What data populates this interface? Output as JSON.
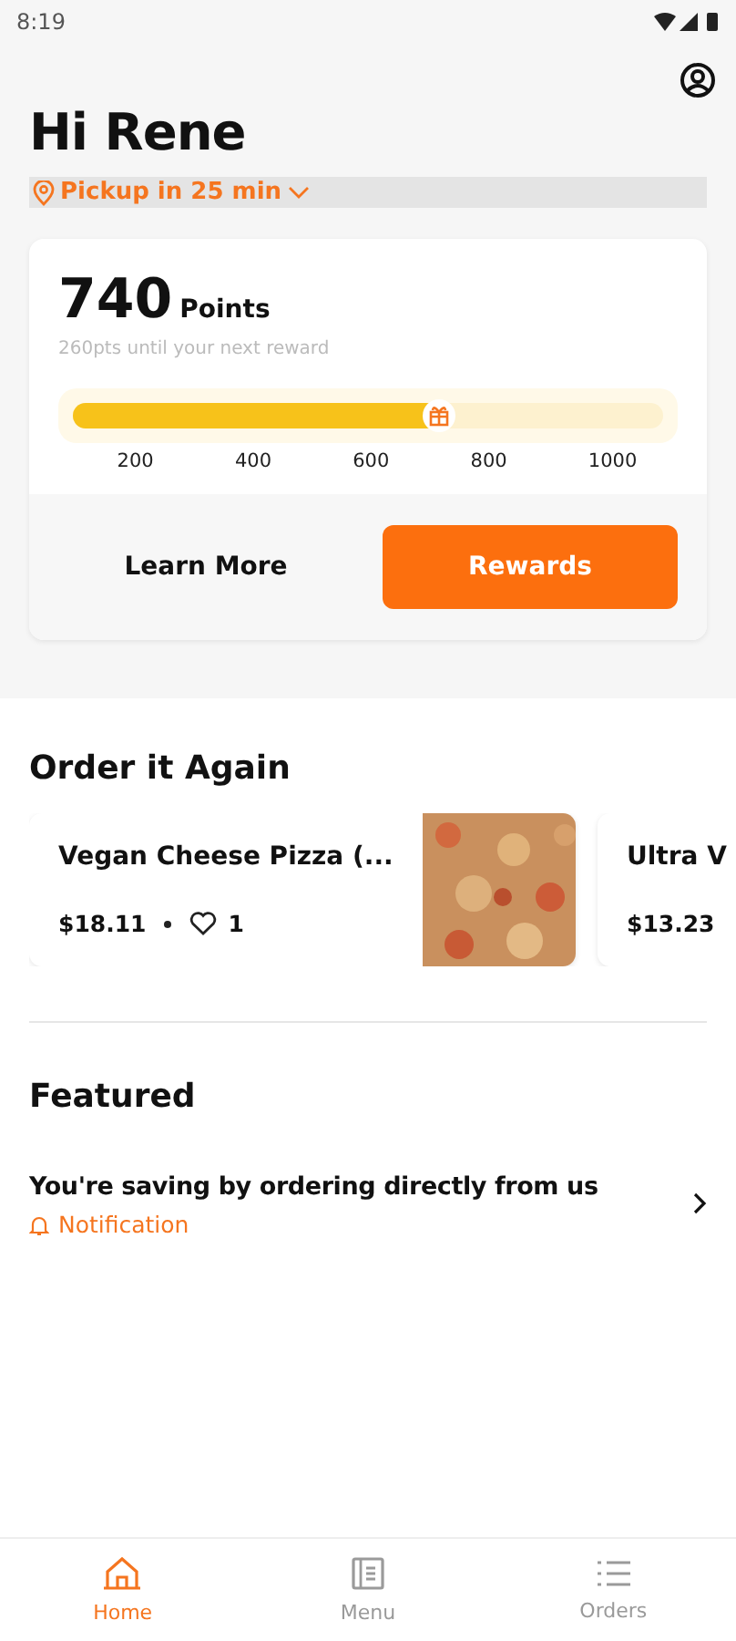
{
  "status_bar": {
    "time": "8:19"
  },
  "greeting": "Hi Rene",
  "pickup": {
    "label": "Pickup in 25 min"
  },
  "rewards": {
    "points": "740",
    "points_label": "Points",
    "subtitle": "260pts until your next reward",
    "level": 0.62,
    "ticks": [
      "200",
      "400",
      "600",
      "800",
      "1000"
    ],
    "learn_more": "Learn More",
    "rewards_button": "Rewards"
  },
  "order_again": {
    "title": "Order it Again",
    "items": [
      {
        "name": "Vegan Cheese Pizza (...",
        "price": "$18.11",
        "likes": "1",
        "kind": "picture"
      },
      {
        "name": "Ultra V",
        "price": "$13.23"
      }
    ]
  },
  "featured": {
    "title": "Featured",
    "items": [
      {
        "title": "You're saving by ordering directly from us",
        "tag": "Notification"
      }
    ]
  },
  "tabs": [
    {
      "label": "Home",
      "selected": true
    },
    {
      "label": "Menu",
      "selected": false
    },
    {
      "label": "Orders",
      "selected": false
    }
  ]
}
